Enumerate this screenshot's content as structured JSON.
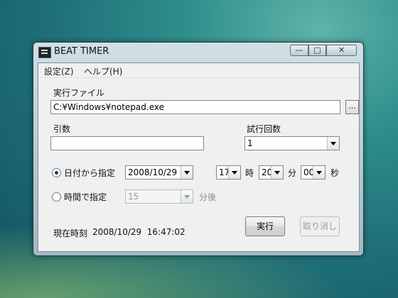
{
  "window": {
    "title": "BEAT TIMER",
    "controls": {
      "minimize": "—",
      "maximize": "□",
      "close": "✕"
    }
  },
  "menu": [
    {
      "label": "設定(Z)"
    },
    {
      "label": "ヘルプ(H)"
    }
  ],
  "exec_file": {
    "label": "実行ファイル",
    "value": "C:¥Windows¥notepad.exe",
    "browse_label": "..."
  },
  "args": {
    "label": "引数",
    "value": ""
  },
  "trials": {
    "label": "試行回数",
    "value": "1"
  },
  "date_mode": {
    "label": "日付から指定",
    "selected": true,
    "date": "2008/10/29",
    "hour": "17",
    "hour_unit": "時",
    "minute": "20",
    "minute_unit": "分",
    "second": "00",
    "second_unit": "秒"
  },
  "time_mode": {
    "label": "時間で指定",
    "selected": false,
    "minutes": "15",
    "unit": "分後"
  },
  "buttons": {
    "run": "実行",
    "cancel": "取り消し"
  },
  "status": {
    "label": "現在時刻",
    "datetime": "2008/10/29  16:47:02"
  }
}
